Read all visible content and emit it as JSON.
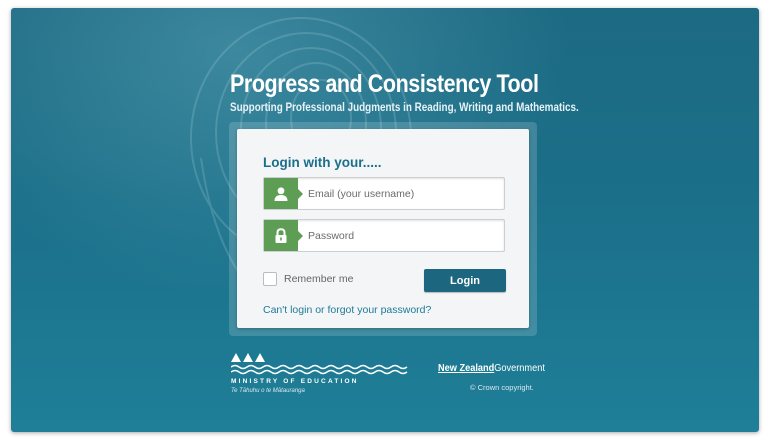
{
  "header": {
    "title": "Progress and Consistency Tool",
    "subtitle": "Supporting Professional Judgments in Reading, Writing and Mathematics."
  },
  "login": {
    "heading": "Login with your.....",
    "email_placeholder": "Email (your username)",
    "email_icon": "user-icon",
    "password_placeholder": "Password",
    "password_icon": "lock-icon",
    "remember_label": "Remember me",
    "remember_checked": false,
    "login_button": "Login",
    "forgot_link": "Can't login or forgot your password?"
  },
  "footer": {
    "ministry": "MINISTRY OF EDUCATION",
    "ministry_maori": "Te Tāhuhu o te Mātauranga",
    "nz_gov_nz": "New Zealand",
    "nz_gov_gov": "Government",
    "copyright": "© Crown copyright."
  },
  "colors": {
    "background": "#1b6f89",
    "icon_green": "#5e9e54",
    "button": "#1d6680",
    "heading_blue": "#1c6f8a",
    "link": "#1f7a9a"
  }
}
